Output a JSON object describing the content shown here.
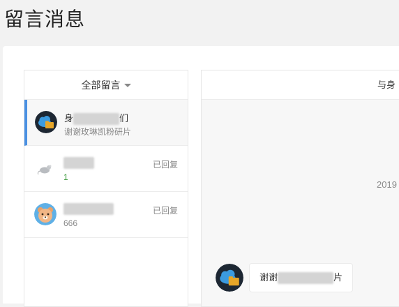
{
  "page": {
    "title": "留言消息"
  },
  "filter": {
    "label": "全部留言",
    "icon": "caret-down-icon"
  },
  "messages": [
    {
      "name_prefix": "身",
      "name_suffix": "们",
      "preview": "谢谢玫琳凯粉研片",
      "status": "",
      "active": true,
      "avatar": "cloud-folder-avatar"
    },
    {
      "name_prefix": "",
      "name_suffix": "",
      "preview": "1",
      "status": "已回复",
      "active": false,
      "avatar": "rat-avatar"
    },
    {
      "name_prefix": "",
      "name_suffix": "",
      "preview": "666",
      "status": "已回复",
      "active": false,
      "avatar": "bear-avatar"
    }
  ],
  "conversation": {
    "header": "与身",
    "date": "2019",
    "bubble_prefix": "谢谢",
    "bubble_suffix": "片"
  },
  "colors": {
    "accent": "#4a90e2",
    "count_green": "#3c9a3c"
  }
}
